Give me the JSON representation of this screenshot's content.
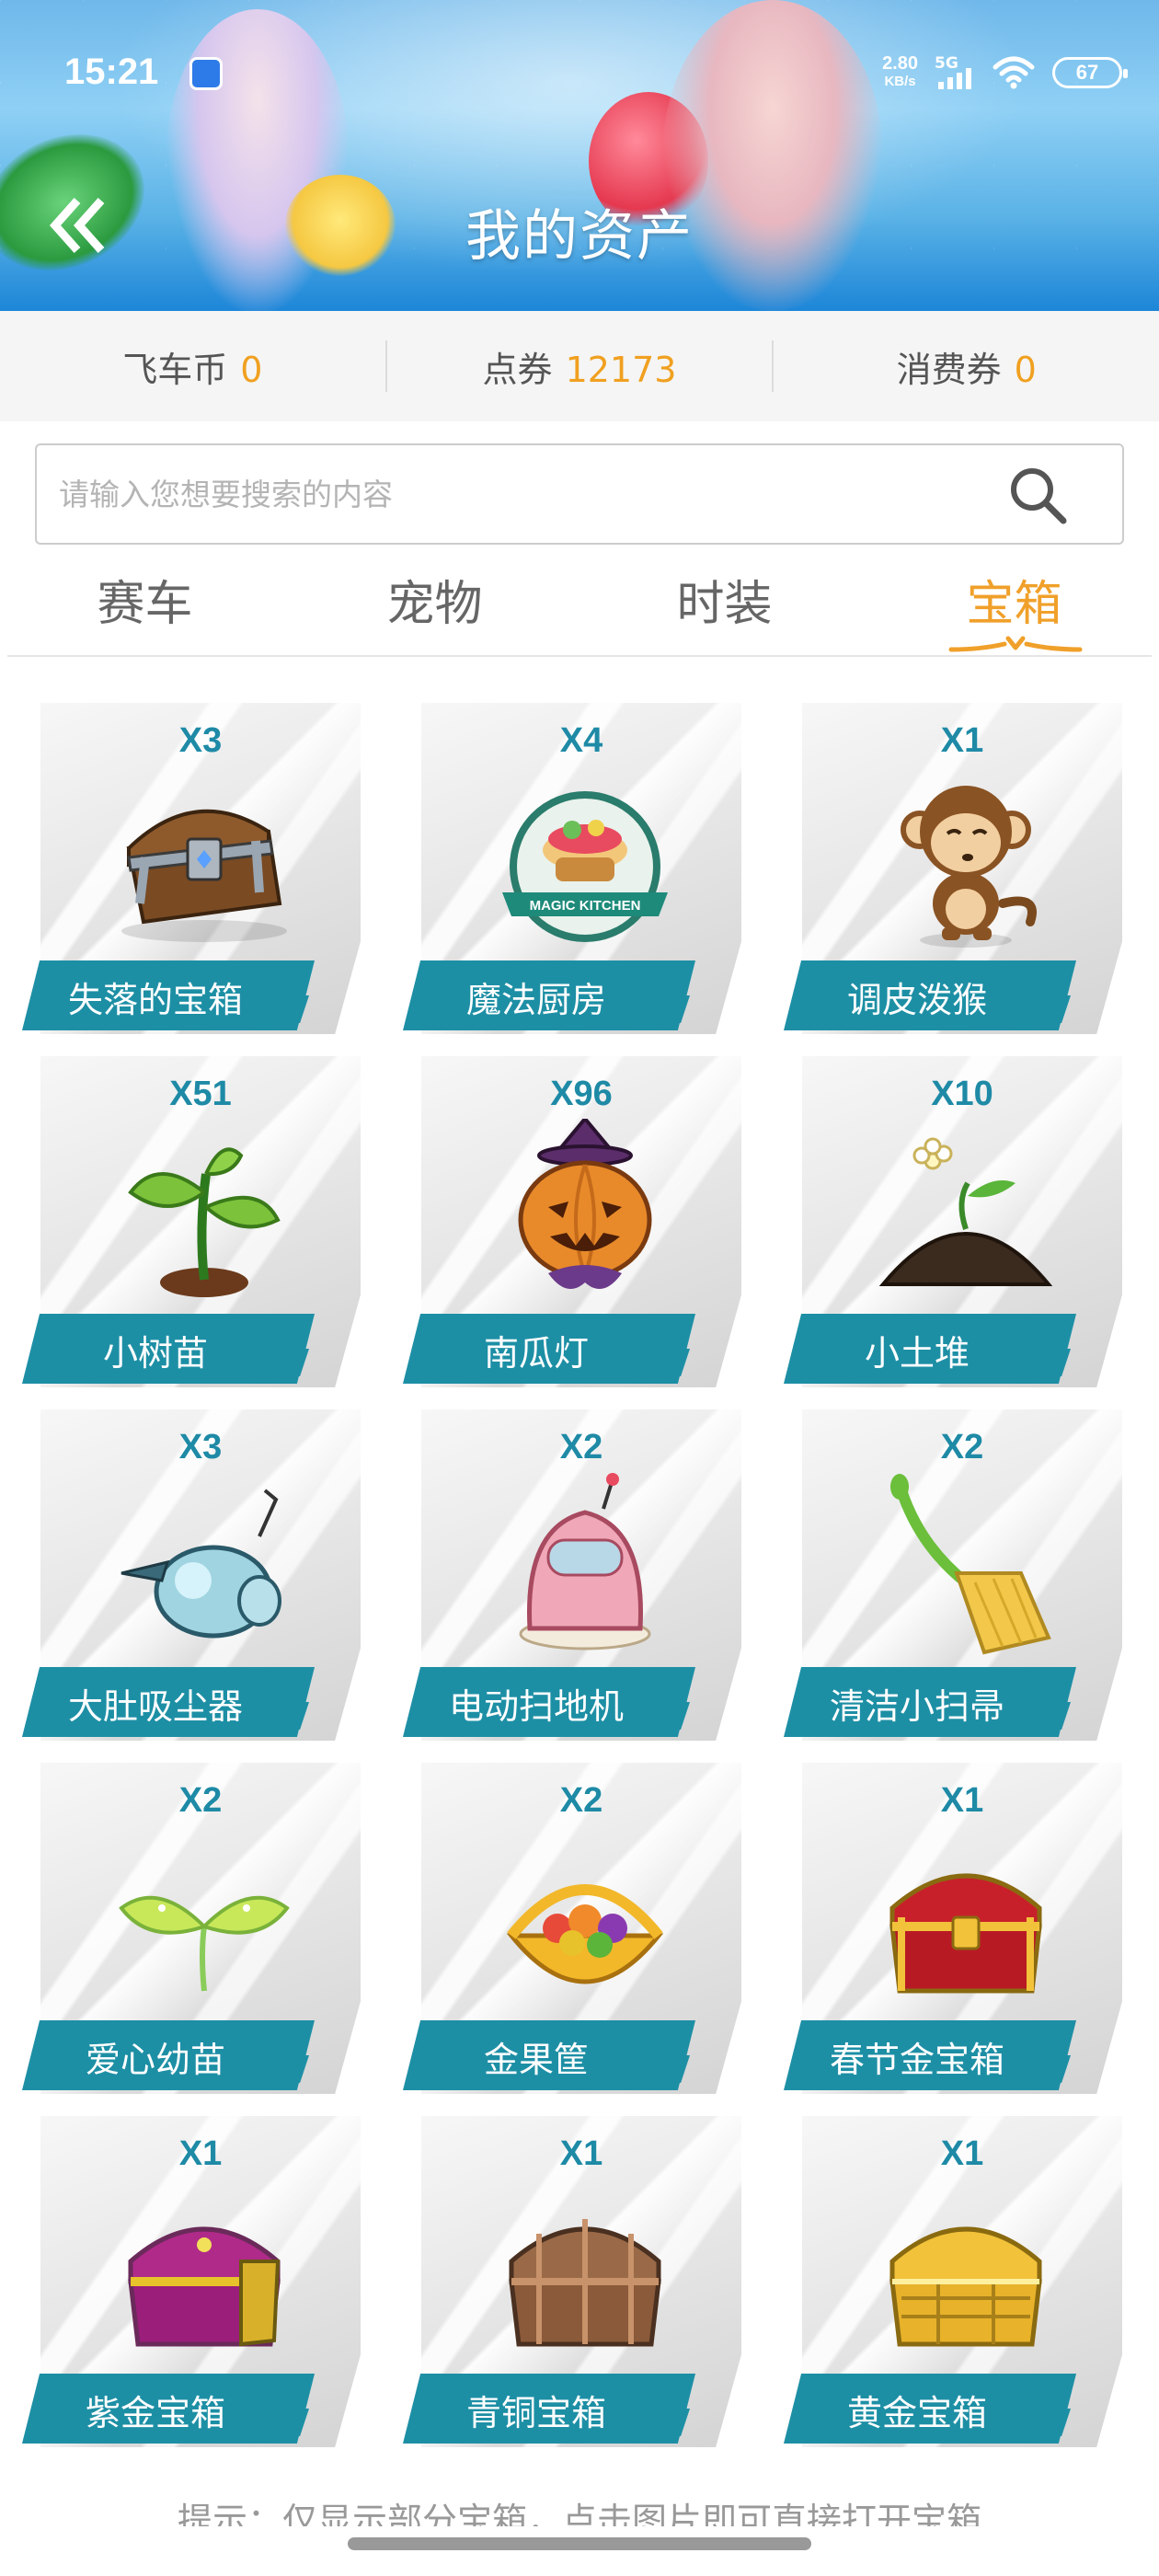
{
  "status_bar": {
    "time": "15:21",
    "net_speed": "2.80",
    "net_speed_unit": "KB/s",
    "network": "5G",
    "battery": "67"
  },
  "header": {
    "title": "我的资产",
    "back_icon": "double-chevron-left-icon"
  },
  "currencies": [
    {
      "label": "飞车币",
      "value": "0"
    },
    {
      "label": "点券",
      "value": "12173"
    },
    {
      "label": "消费券",
      "value": "0"
    }
  ],
  "search": {
    "placeholder": "请输入您想要搜索的内容",
    "value": "",
    "icon": "search-icon"
  },
  "tabs": [
    {
      "label": "赛车",
      "active": false
    },
    {
      "label": "宠物",
      "active": false
    },
    {
      "label": "时装",
      "active": false
    },
    {
      "label": "宝箱",
      "active": true
    }
  ],
  "colors": {
    "accent_orange": "#f0a02a",
    "label_teal": "#1d8fa5",
    "count_teal": "#1e8aa6"
  },
  "items": [
    {
      "name": "失落的宝箱",
      "count": "X3",
      "icon": "treasure-chest-icon"
    },
    {
      "name": "魔法厨房",
      "count": "X4",
      "icon": "magic-kitchen-icon"
    },
    {
      "name": "调皮泼猴",
      "count": "X1",
      "icon": "monkey-icon"
    },
    {
      "name": "小树苗",
      "count": "X51",
      "icon": "sapling-icon"
    },
    {
      "name": "南瓜灯",
      "count": "X96",
      "icon": "pumpkin-lantern-icon"
    },
    {
      "name": "小土堆",
      "count": "X10",
      "icon": "dirt-mound-icon"
    },
    {
      "name": "大肚吸尘器",
      "count": "X3",
      "icon": "vacuum-cleaner-icon"
    },
    {
      "name": "电动扫地机",
      "count": "X2",
      "icon": "robot-sweeper-icon"
    },
    {
      "name": "清洁小扫帚",
      "count": "X2",
      "icon": "broom-icon"
    },
    {
      "name": "爱心幼苗",
      "count": "X2",
      "icon": "heart-sprout-icon"
    },
    {
      "name": "金果筐",
      "count": "X2",
      "icon": "golden-fruit-basket-icon"
    },
    {
      "name": "春节金宝箱",
      "count": "X1",
      "icon": "spring-festival-chest-icon"
    },
    {
      "name": "紫金宝箱",
      "count": "X1",
      "icon": "purple-gold-chest-icon"
    },
    {
      "name": "青铜宝箱",
      "count": "X1",
      "icon": "bronze-chest-icon"
    },
    {
      "name": "黄金宝箱",
      "count": "X1",
      "icon": "gold-chest-icon"
    }
  ],
  "hint": "提示：仅显示部分宝箱，点击图片即可直接打开宝箱"
}
